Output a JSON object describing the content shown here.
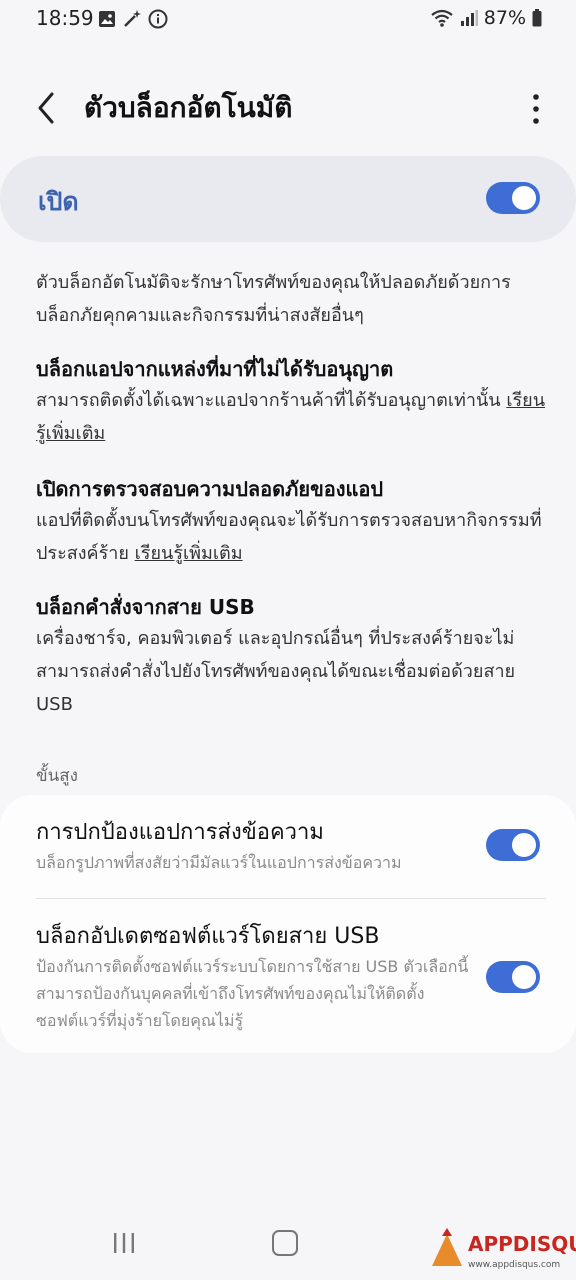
{
  "status_bar": {
    "time": "18:59",
    "battery": "87%",
    "icons_left": [
      "image-icon",
      "magic-wand-icon",
      "info-icon"
    ],
    "icons_right": [
      "wifi-icon",
      "signal-icon",
      "battery-icon"
    ]
  },
  "header": {
    "title": "ตัวบล็อกอัตโนมัติ"
  },
  "main_toggle": {
    "label": "เปิด",
    "on": true
  },
  "description": "ตัวบล็อกอัตโนมัติจะรักษาโทรศัพท์ของคุณให้ปลอดภัยด้วยการบล็อกภัยคุกคามและกิจกรรมที่น่าสงสัยอื่นๆ",
  "sections": [
    {
      "title": "บล็อกแอปจากแหล่งที่มาที่ไม่ได้รับอนุญาต",
      "text": "สามารถติดตั้งได้เฉพาะแอปจากร้านค้าที่ได้รับอนุญาตเท่านั้น",
      "link": "เรียนรู้เพิ่มเติม"
    },
    {
      "title": "เปิดการตรวจสอบความปลอดภัยของแอป",
      "text": "แอปที่ติดตั้งบนโทรศัพท์ของคุณจะได้รับการตรวจสอบหากิจกรรมที่ประสงค์ร้าย",
      "link": "เรียนรู้เพิ่มเติม"
    },
    {
      "title": "บล็อกคำสั่งจากสาย USB",
      "text": "เครื่องชาร์จ, คอมพิวเตอร์ และอุปกรณ์อื่นๆ ที่ประสงค์ร้ายจะไม่สามารถส่งคำสั่งไปยังโทรศัพท์ของคุณได้ขณะเชื่อมต่อด้วยสาย USB"
    }
  ],
  "advanced": {
    "label": "ขั้นสูง",
    "items": [
      {
        "title": "การปกป้องแอปการส่งข้อความ",
        "subtitle": "บล็อกรูปภาพที่สงสัยว่ามีมัลแวร์ในแอปการส่งข้อความ",
        "on": true
      },
      {
        "title": "บล็อกอัปเดตซอฟต์แวร์โดยสาย USB",
        "subtitle": "ป้องกันการติดตั้งซอฟต์แวร์ระบบโดยการใช้สาย USB ตัวเลือกนี้สามารถป้องกันบุคคลที่เข้าถึงโทรศัพท์ของคุณไม่ให้ติดตั้งซอฟต์แวร์ที่มุ่งร้ายโดยคุณไม่รู้",
        "on": true
      }
    ]
  },
  "watermark": {
    "brand": "APPDISQUS",
    "url": "www.appdisqus.com"
  },
  "colors": {
    "accent": "#3e6dd6",
    "main_label": "#3c62b0",
    "background": "#f6f6f8"
  }
}
